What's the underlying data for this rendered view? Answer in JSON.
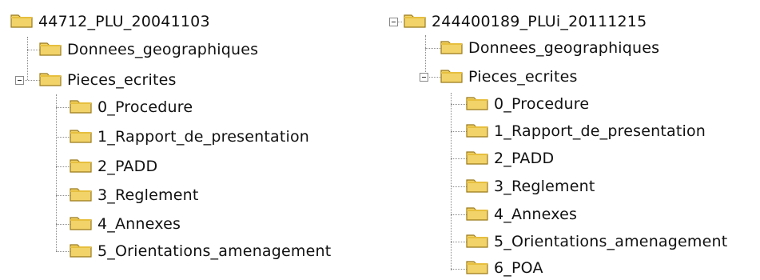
{
  "left_tree": {
    "root": "44712_PLU_20041103",
    "children": [
      "Donnees_geographiques",
      "Pieces_ecrites"
    ],
    "pieces_ecrites_children": [
      "0_Procedure",
      "1_Rapport_de_presentation",
      "2_PADD",
      "3_Reglement",
      "4_Annexes",
      "5_Orientations_amenagement"
    ]
  },
  "right_tree": {
    "root": "244400189_PLUi_20111215",
    "children": [
      "Donnees_geographiques",
      "Pieces_ecrites"
    ],
    "pieces_ecrites_children": [
      "0_Procedure",
      "1_Rapport_de_presentation",
      "2_PADD",
      "3_Reglement",
      "4_Annexes",
      "5_Orientations_amenagement",
      "6_POA"
    ]
  },
  "icons": {
    "folder": "folder-icon",
    "expander": "collapse-minus-icon"
  },
  "colors": {
    "folder_fill": "#f1d36a",
    "folder_stroke": "#9b7a1b",
    "folder_tab": "#e7bf3f"
  }
}
